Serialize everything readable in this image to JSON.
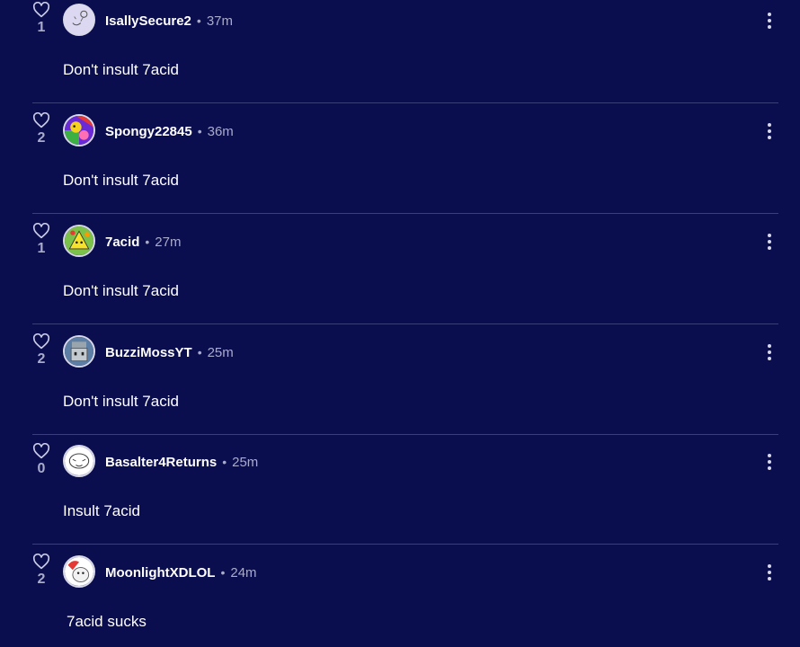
{
  "colors": {
    "background": "#0a0e4e",
    "divider": "#3a3f78",
    "username": "#ffffff",
    "muted": "#a9abcc"
  },
  "comments": [
    {
      "likes": "1",
      "username": "IsallySecure2",
      "separator": "•",
      "time": "37m",
      "text": "Don't insult 7acid",
      "avatar_icon": "avatar-doodle-icon"
    },
    {
      "likes": "2",
      "username": "Spongy22845",
      "separator": "•",
      "time": "36m",
      "text": "Don't insult 7acid",
      "avatar_icon": "avatar-colorful-icon"
    },
    {
      "likes": "1",
      "username": "7acid",
      "separator": "•",
      "time": "27m",
      "text": "Don't insult 7acid",
      "avatar_icon": "avatar-yellow-icon"
    },
    {
      "likes": "2",
      "username": "BuzziMossYT",
      "separator": "•",
      "time": "25m",
      "text": "Don't insult 7acid",
      "avatar_icon": "avatar-robot-icon"
    },
    {
      "likes": "0",
      "username": "Basalter4Returns",
      "separator": "•",
      "time": "25m",
      "text": "Insult 7acid",
      "avatar_icon": "avatar-sketch-icon"
    },
    {
      "likes": "2",
      "username": "MoonlightXDLOL",
      "separator": "•",
      "time": "24m",
      "text": "7acid sucks",
      "avatar_icon": "avatar-cartoon-icon"
    }
  ]
}
